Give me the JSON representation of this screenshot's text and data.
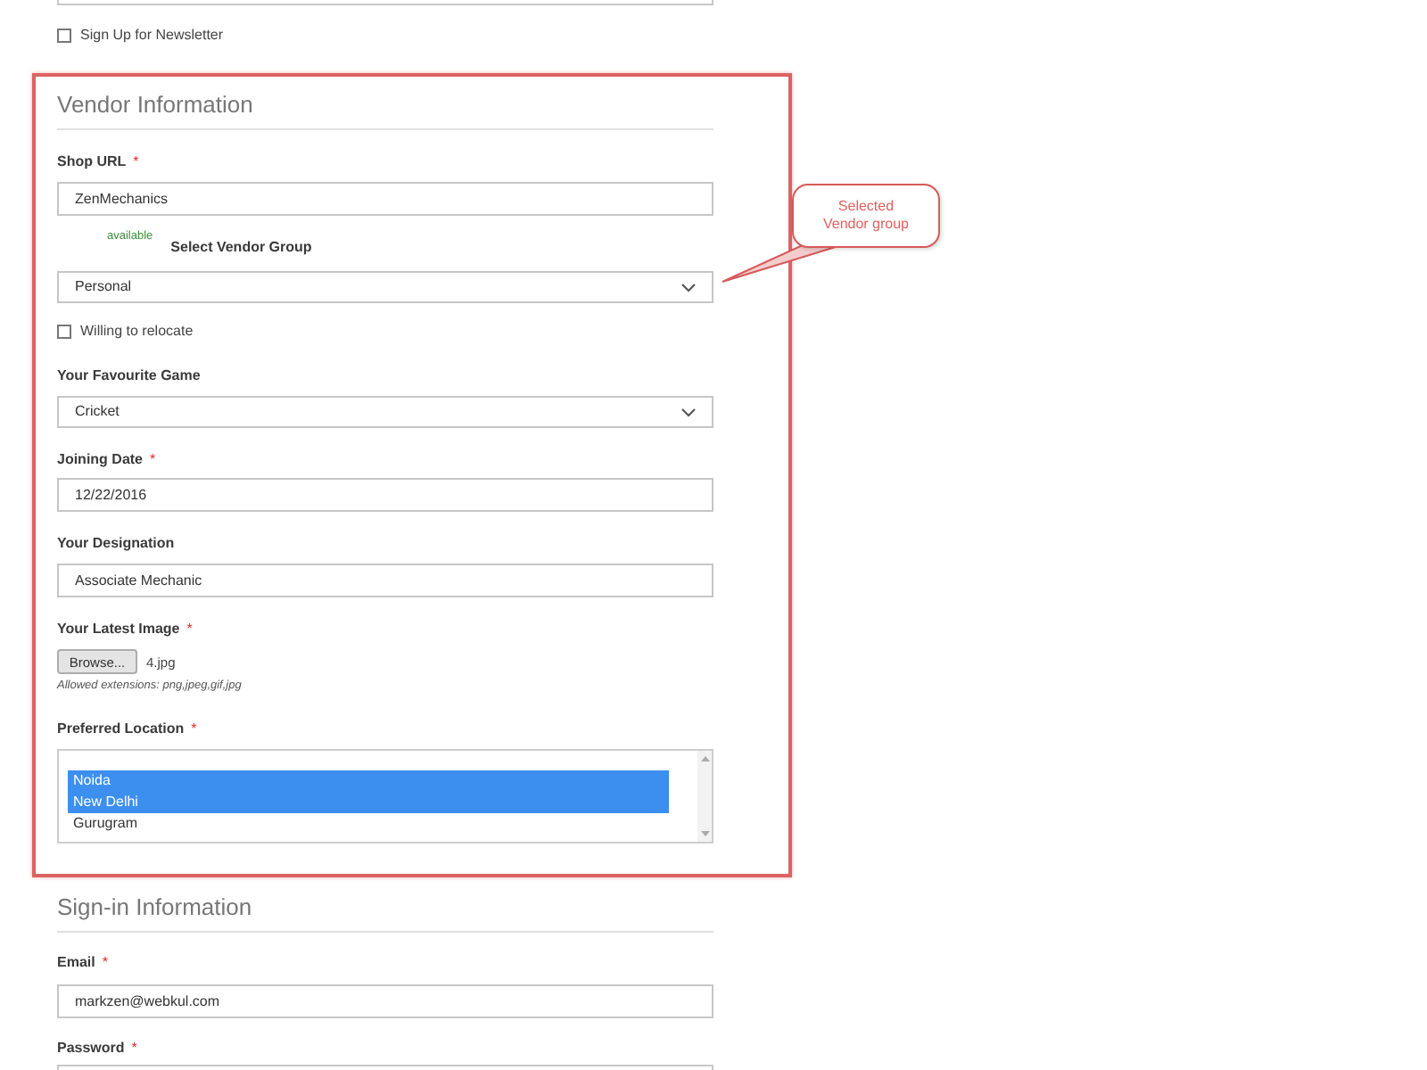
{
  "newsletter": {
    "label": "Sign Up for Newsletter",
    "checked": false
  },
  "vendor_information": {
    "title": "Vendor Information",
    "shop_url": {
      "label": "Shop URL",
      "required_mark": "*",
      "value": "ZenMechanics",
      "availability": "available"
    },
    "vendor_group": {
      "label": "Select Vendor Group",
      "value": "Personal"
    },
    "relocate": {
      "label": "Willing to relocate",
      "checked": false
    },
    "favourite_game": {
      "label": "Your Favourite Game",
      "value": "Cricket"
    },
    "joining_date": {
      "label": "Joining Date",
      "required_mark": "*",
      "value": "12/22/2016"
    },
    "designation": {
      "label": "Your Designation",
      "value": "Associate Mechanic"
    },
    "latest_image": {
      "label": "Your Latest Image",
      "required_mark": "*",
      "button": "Browse...",
      "file_name": "4.jpg",
      "note": "Allowed extensions: png,jpeg,gif,jpg"
    },
    "preferred_location": {
      "label": "Preferred Location",
      "required_mark": "*",
      "options": [
        {
          "label": "Noida",
          "selected": true
        },
        {
          "label": "New Delhi",
          "selected": true
        },
        {
          "label": "Gurugram",
          "selected": false
        }
      ]
    }
  },
  "sign_in_information": {
    "title": "Sign-in Information",
    "email": {
      "label": "Email",
      "required_mark": "*",
      "value": "markzen@webkul.com"
    },
    "password": {
      "label": "Password",
      "required_mark": "*"
    }
  },
  "callout": {
    "text": "Selected Vendor group"
  }
}
